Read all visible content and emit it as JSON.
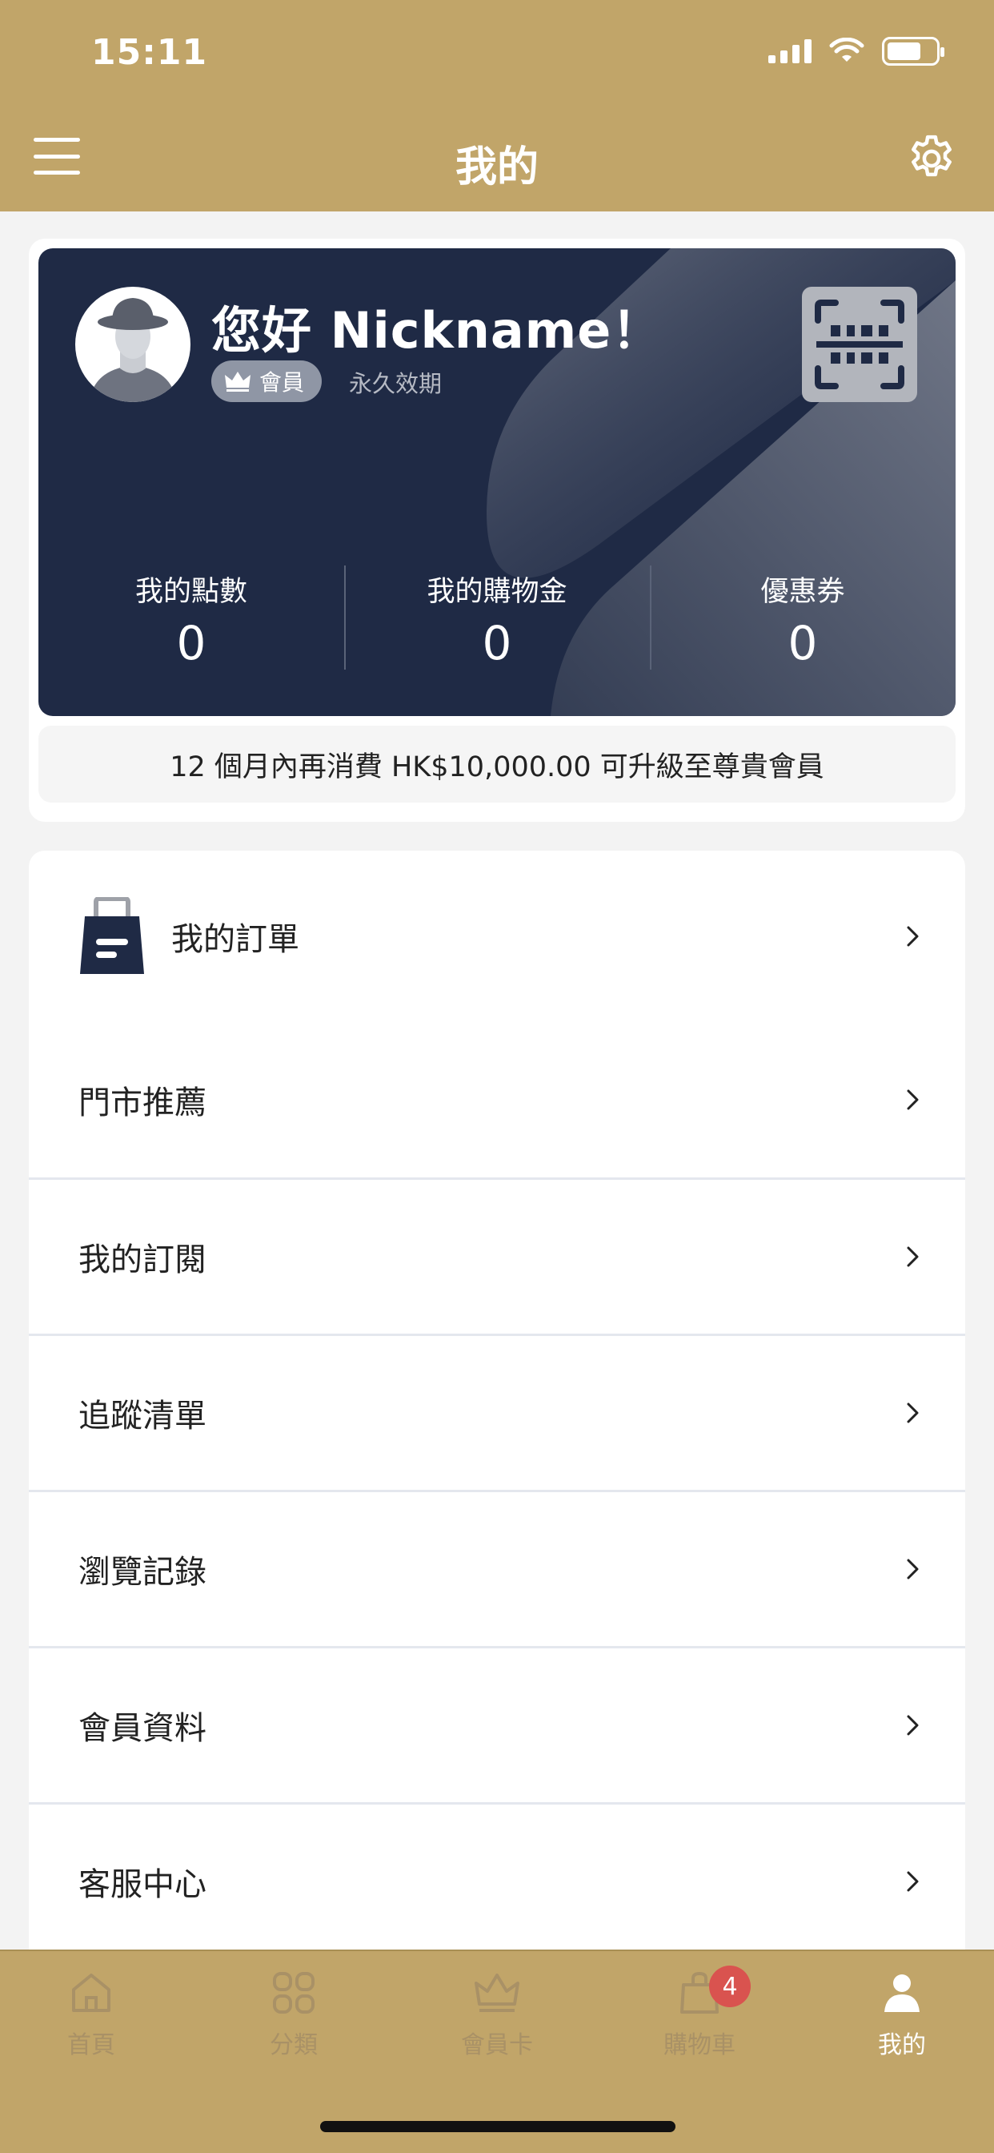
{
  "status_bar": {
    "time": "15:11"
  },
  "header": {
    "title": "我的"
  },
  "member_card": {
    "greeting": "您好 Nickname！",
    "badge_label": "會員",
    "validity": "永久效期",
    "stats": [
      {
        "label": "我的點數",
        "value": "0"
      },
      {
        "label": "我的購物金",
        "value": "0"
      },
      {
        "label": "優惠券",
        "value": "0"
      }
    ],
    "upgrade_notice": "12 個月內再消費 HK$10,000.00 可升級至尊貴會員"
  },
  "menu": {
    "orders_label": "我的訂單",
    "items": [
      {
        "label": "門市推薦"
      },
      {
        "label": "我的訂閱"
      },
      {
        "label": "追蹤清單"
      },
      {
        "label": "瀏覽記錄"
      },
      {
        "label": "會員資料"
      },
      {
        "label": "客服中心"
      }
    ]
  },
  "tabbar": {
    "tabs": [
      {
        "label": "首頁",
        "icon": "home-icon"
      },
      {
        "label": "分類",
        "icon": "category-icon"
      },
      {
        "label": "會員卡",
        "icon": "crown-icon"
      },
      {
        "label": "購物車",
        "icon": "shopping-bag-icon",
        "badge": "4"
      },
      {
        "label": "我的",
        "icon": "person-icon",
        "active": true
      }
    ]
  },
  "colors": {
    "brand_gold": "#c1a569",
    "card_navy": "#1f2a45",
    "badge_red": "#d9534f"
  }
}
